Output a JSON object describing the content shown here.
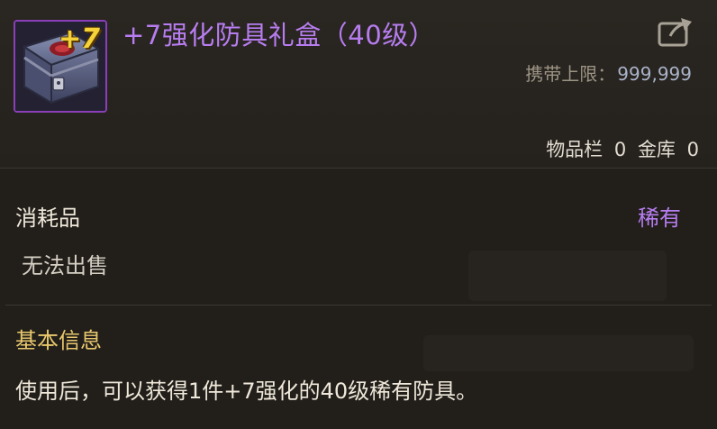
{
  "item": {
    "badge": "+7",
    "title": "+7强化防具礼盒（40级）",
    "carry_limit_label": "携带上限：",
    "carry_limit_value": "999,999"
  },
  "storage": {
    "inventory_label": "物品栏",
    "inventory_count": "0",
    "vault_label": "金库",
    "vault_count": "0"
  },
  "category": "消耗品",
  "rarity": "稀有",
  "sell_state": "无法出售",
  "basic_info": {
    "heading": "基本信息",
    "description": "使用后，可以获得1件+7强化的40级稀有防具。"
  },
  "colors": {
    "rarity_purple": "#b77df0",
    "heading_gold": "#e9c86c",
    "frame_purple": "#8a3fb8"
  },
  "icons": {
    "item_icon": "treasure-chest-icon",
    "share": "share-out-icon"
  }
}
